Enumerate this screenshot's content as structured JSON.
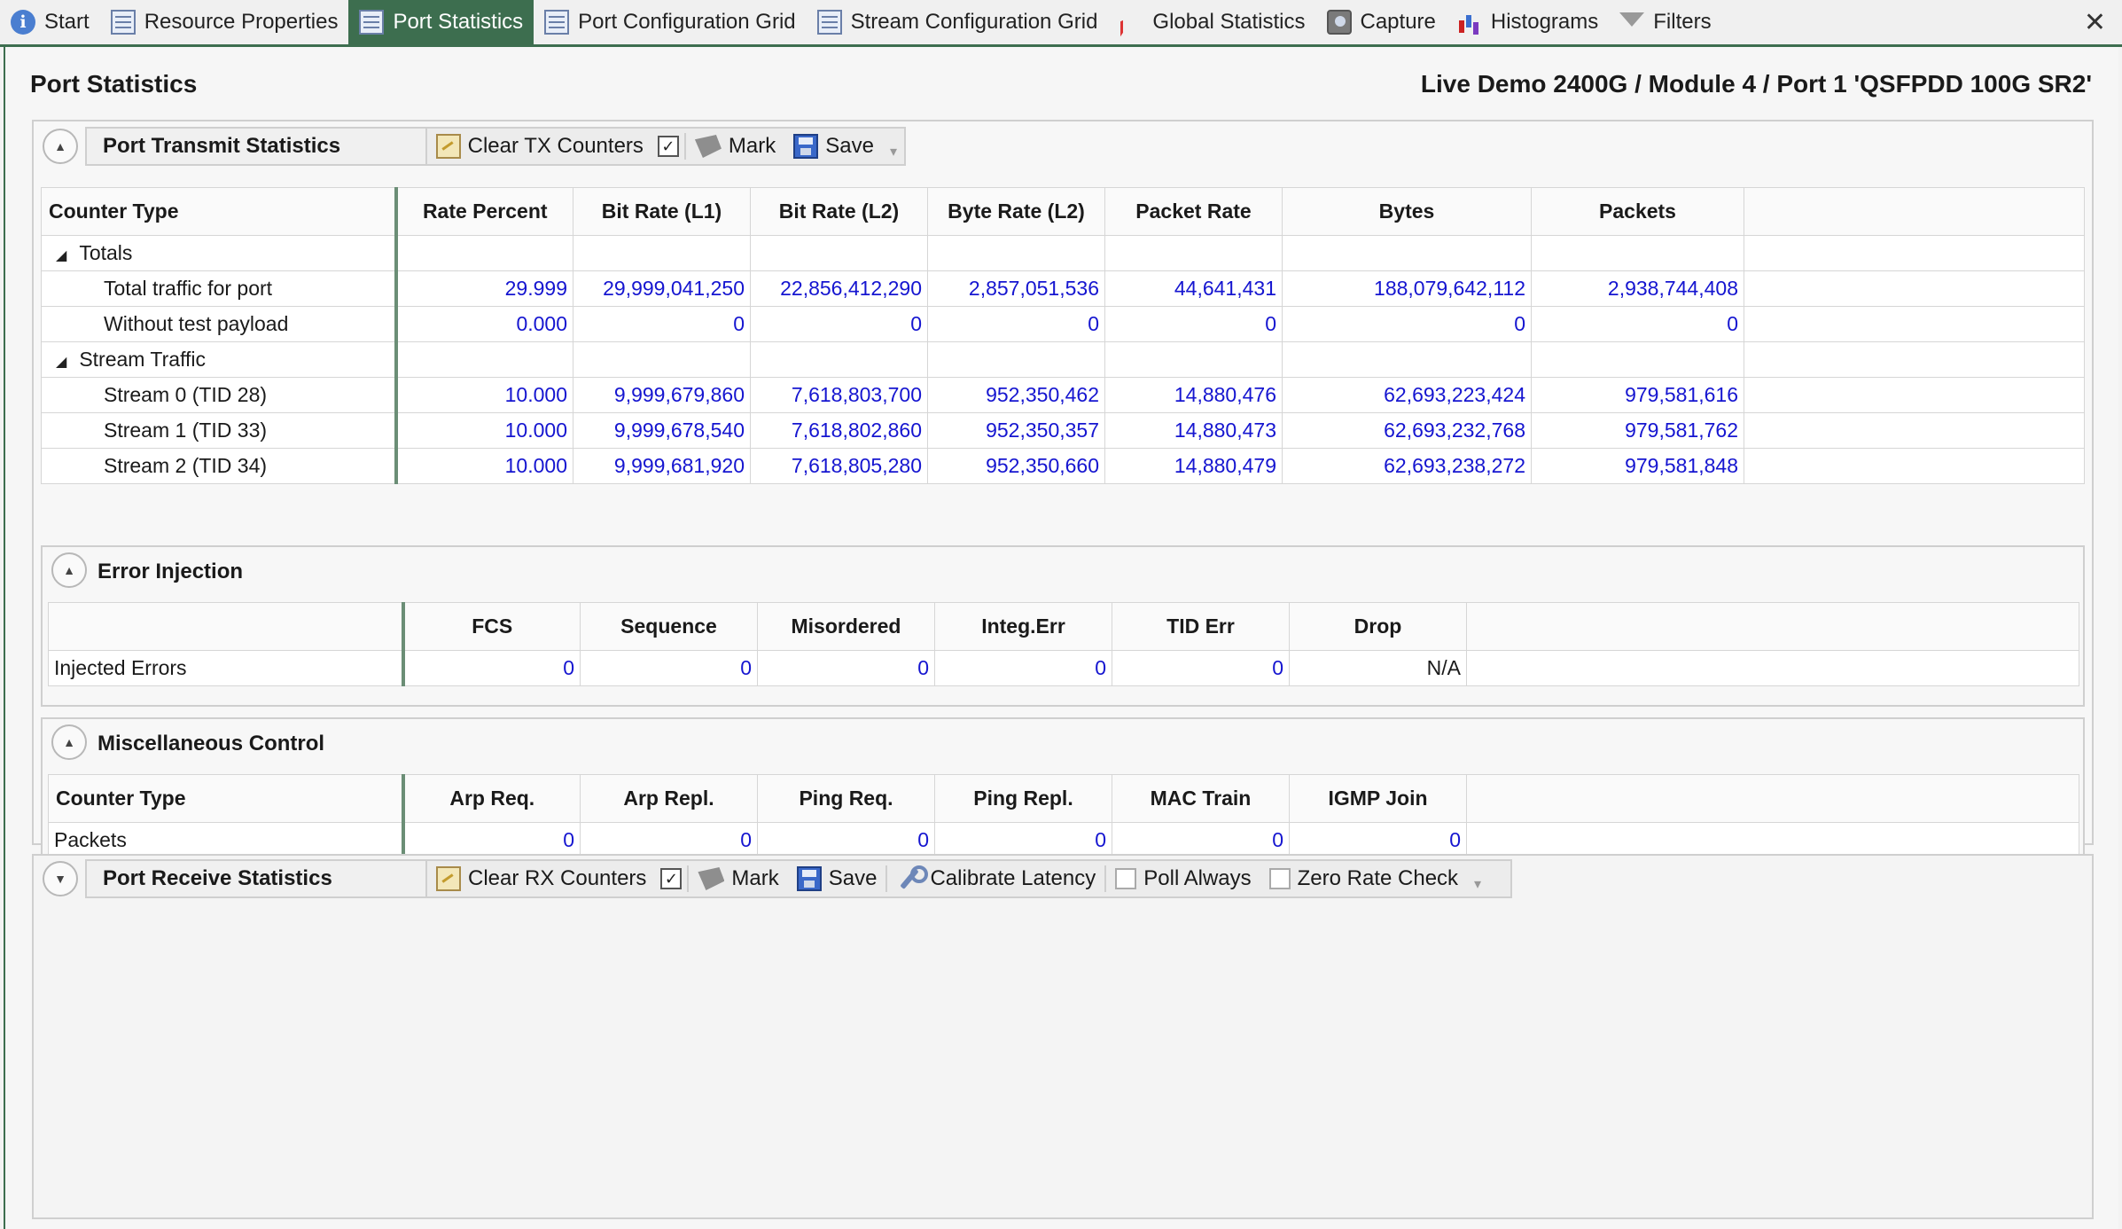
{
  "tabs": [
    {
      "label": "Start",
      "icon": "info-icon"
    },
    {
      "label": "Resource Properties",
      "icon": "grid-icon"
    },
    {
      "label": "Port Statistics",
      "icon": "grid-icon",
      "active": true
    },
    {
      "label": "Port Configuration Grid",
      "icon": "grid-icon"
    },
    {
      "label": "Stream Configuration Grid",
      "icon": "grid-icon"
    },
    {
      "label": "Global Statistics",
      "icon": "chart-icon"
    },
    {
      "label": "Capture",
      "icon": "camera-icon"
    },
    {
      "label": "Histograms",
      "icon": "histogram-icon"
    },
    {
      "label": "Filters",
      "icon": "filter-icon"
    }
  ],
  "close_glyph": "✕",
  "header": {
    "title": "Port Statistics",
    "device_path": "Live Demo 2400G / Module 4 / Port 1 'QSFPDD 100G SR2'"
  },
  "tx": {
    "title": "Port Transmit Statistics",
    "clear_label": "Clear TX Counters",
    "mark_label": "Mark",
    "save_label": "Save",
    "columns": [
      "Counter Type",
      "Rate Percent",
      "Bit Rate (L1)",
      "Bit Rate (L2)",
      "Byte Rate (L2)",
      "Packet Rate",
      "Bytes",
      "Packets"
    ],
    "groups": [
      {
        "name": "Totals",
        "rows": [
          {
            "label": "Total traffic for port",
            "values": [
              "29.999",
              "29,999,041,250",
              "22,856,412,290",
              "2,857,051,536",
              "44,641,431",
              "188,079,642,112",
              "2,938,744,408"
            ]
          },
          {
            "label": "Without test payload",
            "values": [
              "0.000",
              "0",
              "0",
              "0",
              "0",
              "0",
              "0"
            ]
          }
        ]
      },
      {
        "name": "Stream Traffic",
        "rows": [
          {
            "label": "Stream 0 (TID 28)",
            "values": [
              "10.000",
              "9,999,679,860",
              "7,618,803,700",
              "952,350,462",
              "14,880,476",
              "62,693,223,424",
              "979,581,616"
            ]
          },
          {
            "label": "Stream 1 (TID 33)",
            "values": [
              "10.000",
              "9,999,678,540",
              "7,618,802,860",
              "952,350,357",
              "14,880,473",
              "62,693,232,768",
              "979,581,762"
            ]
          },
          {
            "label": "Stream 2 (TID 34)",
            "values": [
              "10.000",
              "9,999,681,920",
              "7,618,805,280",
              "952,350,660",
              "14,880,479",
              "62,693,238,272",
              "979,581,848"
            ]
          }
        ]
      }
    ]
  },
  "error_injection": {
    "title": "Error Injection",
    "columns": [
      "",
      "FCS",
      "Sequence",
      "Misordered",
      "Integ.Err",
      "TID Err",
      "Drop"
    ],
    "row": {
      "label": "Injected Errors",
      "values": [
        "0",
        "0",
        "0",
        "0",
        "0",
        "N/A"
      ]
    }
  },
  "misc": {
    "title": "Miscellaneous Control",
    "columns": [
      "Counter Type",
      "Arp Req.",
      "Arp Repl.",
      "Ping Req.",
      "Ping Repl.",
      "MAC Train",
      "IGMP Join"
    ],
    "row": {
      "label": "Packets",
      "values": [
        "0",
        "0",
        "0",
        "0",
        "0",
        "0"
      ]
    }
  },
  "rx": {
    "title": "Port Receive Statistics",
    "clear_label": "Clear RX Counters",
    "mark_label": "Mark",
    "save_label": "Save",
    "calibrate_label": "Calibrate Latency",
    "poll_always_label": "Poll Always",
    "zero_rate_label": "Zero Rate Check",
    "poll_always_checked": false,
    "zero_rate_checked": false
  },
  "tx_autocheck_checked": true,
  "rx_autocheck_checked": true,
  "colors": {
    "accent": "#3d6e4f",
    "value": "#1515d0"
  }
}
